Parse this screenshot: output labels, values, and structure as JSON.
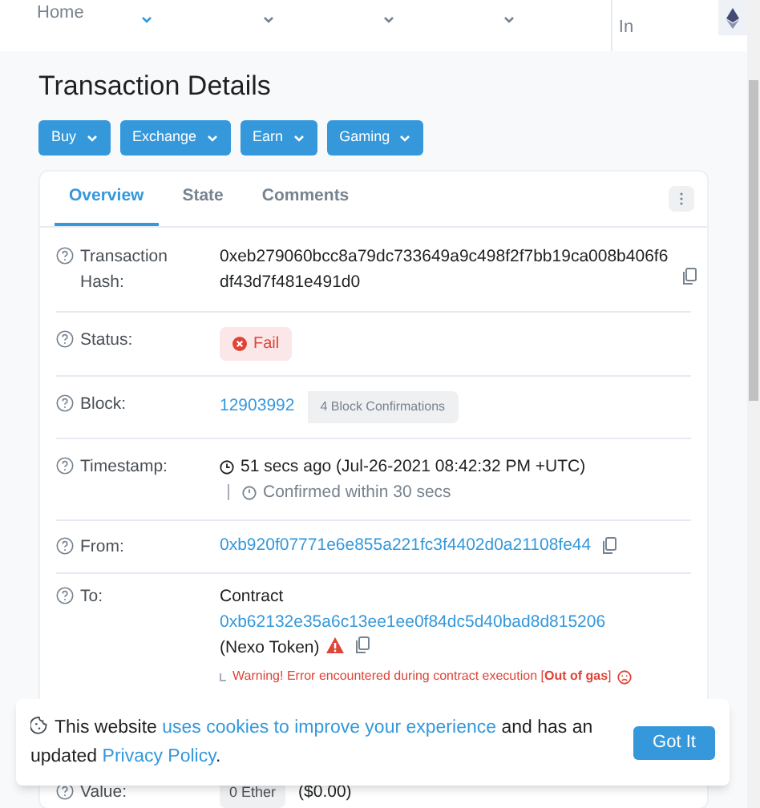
{
  "nav": [
    {
      "label": "Home",
      "selected": false,
      "dropdown": false
    },
    {
      "selected": true,
      "dropdown": true
    },
    {
      "selected": false,
      "dropdown": true
    },
    {
      "selected": false,
      "dropdown": true
    },
    {
      "selected": false,
      "dropdown": true
    },
    {
      "label": "In",
      "selected": false,
      "dropdown": false
    }
  ],
  "page_title": "Transaction Details",
  "action_buttons": [
    "Buy",
    "Exchange",
    "Earn",
    "Gaming"
  ],
  "tabs": [
    {
      "label": "Overview",
      "selected": true
    },
    {
      "label": "State",
      "selected": false
    },
    {
      "label": "Comments",
      "selected": false
    }
  ],
  "rows": [
    {
      "kind": "hash",
      "label": "Transaction Hash:",
      "value": "0xeb279060bcc8a79dc733649a9c498f2f7bb19ca008b406f6df43d7f481e491d0"
    },
    {
      "kind": "status",
      "label": "Status:",
      "value": "Fail"
    },
    {
      "kind": "block",
      "label": "Block:",
      "value": "12903992",
      "badge": "4 Block Confirmations"
    },
    {
      "kind": "timestamp",
      "label": "Timestamp:",
      "value": "51 secs ago (Jul-26-2021 08:42:32 PM +UTC)",
      "note": "Confirmed within 30 secs"
    },
    {
      "kind": "from",
      "label": "From:",
      "value": "0xb920f07771e6e855a221fc3f4402d0a21108fe44"
    },
    {
      "kind": "to",
      "label": "To:",
      "prefix": "Contract",
      "value": "0xb62132e35a6c13ee1ee0f84dc5d40bad8d815206",
      "name": "(Nexo Token)",
      "warning": "Warning! Error encountered during contract execution [**Out of gas**]"
    },
    {
      "kind": "value",
      "label": "Value:",
      "value": "0 Ether",
      "note": "($0.00)"
    }
  ],
  "cookie_banner": {
    "before": "This website",
    "link": "uses cookies to improve your experience",
    "middle": "and has an updated",
    "policy": "Privacy Policy",
    "end": ".",
    "button": "Got It"
  }
}
